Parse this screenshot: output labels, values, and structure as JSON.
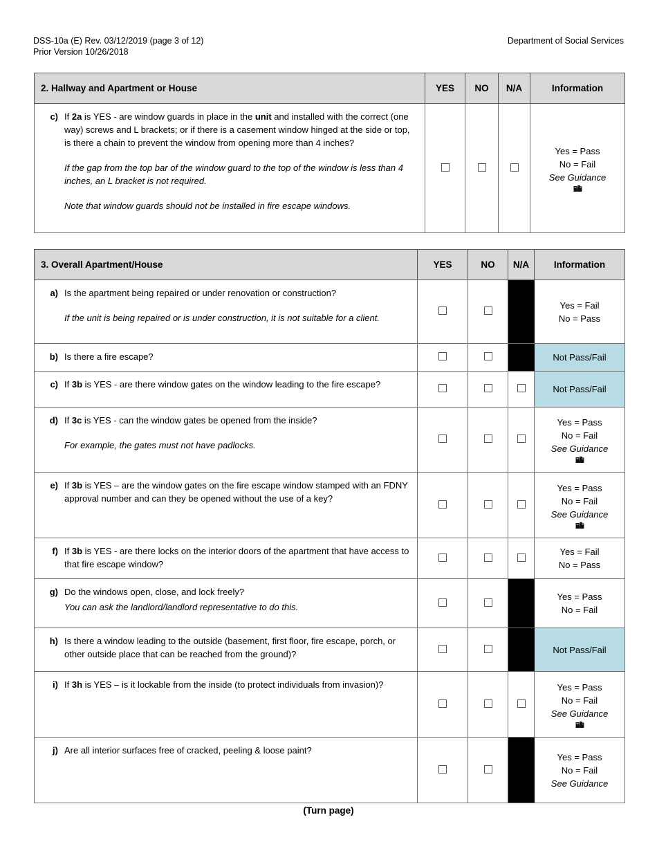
{
  "header": {
    "left_line1": "DSS-10a (E) Rev. 03/12/2019 (page 3 of 12)",
    "left_line2": "Prior Version 10/26/2018",
    "right": "Department of Social Services"
  },
  "colors": {
    "header_gray": "#d9d9d9",
    "not_pass_fail_blue": "#b7dce5",
    "blocked_cell": "#000000",
    "border": "#6f6f6f"
  },
  "columns": {
    "yes": "YES",
    "no": "NO",
    "na": "N/A",
    "information": "Information"
  },
  "section2": {
    "title": "2. Hallway and Apartment or House",
    "rows": [
      {
        "letter": "c)",
        "text_pre": "If ",
        "text_bold1": "2a",
        "text_mid1": " is YES - are window guards in place in the ",
        "text_bold2": "unit",
        "text_post": " and installed with the correct (one way) screws and L brackets; or if there is a casement window hinged at the side or top, is there a chain to prevent the window from opening more than 4 inches?",
        "note1": "If the gap from the top bar of the window guard to the top of the window is less than 4 inches, an L bracket is not required.",
        "note2": "Note that window guards should not be installed in fire escape windows.",
        "yes_checkbox": true,
        "no_checkbox": true,
        "na_checkbox": true,
        "na_blocked": false,
        "info_lines": [
          "Yes = Pass",
          "No = Fail",
          "See Guidance"
        ],
        "info_italic_index": 2,
        "info_blue": false,
        "info_icon": "guidance-books-icon"
      }
    ]
  },
  "section3": {
    "title": "3. Overall Apartment/House",
    "rows": [
      {
        "letter": "a)",
        "text_pre": "Is the apartment being repaired or under renovation or construction?",
        "text_bold1": "",
        "text_mid1": "",
        "text_bold2": "",
        "text_post": "",
        "note1": "If the unit is being repaired or is under construction, it is not suitable for a client.",
        "note2": "",
        "yes_checkbox": true,
        "no_checkbox": true,
        "na_checkbox": false,
        "na_blocked": true,
        "info_lines": [
          "Yes = Fail",
          "No = Pass"
        ],
        "info_italic_index": -1,
        "info_blue": false,
        "info_icon": ""
      },
      {
        "letter": "b)",
        "text_pre": "Is there a fire escape?",
        "text_bold1": "",
        "text_mid1": "",
        "text_bold2": "",
        "text_post": "",
        "note1": "",
        "note2": "",
        "yes_checkbox": true,
        "no_checkbox": true,
        "na_checkbox": false,
        "na_blocked": true,
        "info_lines": [
          "Not Pass/Fail"
        ],
        "info_italic_index": -1,
        "info_blue": true,
        "info_icon": ""
      },
      {
        "letter": "c)",
        "text_pre": "If ",
        "text_bold1": "3b",
        "text_mid1": " is YES - are there window gates on the window leading to the fire escape?",
        "text_bold2": "",
        "text_post": "",
        "note1": "",
        "note2": "",
        "yes_checkbox": true,
        "no_checkbox": true,
        "na_checkbox": true,
        "na_blocked": false,
        "info_lines": [
          "Not Pass/Fail"
        ],
        "info_italic_index": -1,
        "info_blue": true,
        "info_icon": ""
      },
      {
        "letter": "d)",
        "text_pre": "If ",
        "text_bold1": "3c",
        "text_mid1": " is YES - can the window gates be opened from the inside?",
        "text_bold2": "",
        "text_post": "",
        "note1": "For example, the gates must not have padlocks.",
        "note2": "",
        "yes_checkbox": true,
        "no_checkbox": true,
        "na_checkbox": true,
        "na_blocked": false,
        "info_lines": [
          "Yes = Pass",
          "No = Fail",
          "See Guidance"
        ],
        "info_italic_index": 2,
        "info_blue": false,
        "info_icon": "guidance-books-icon"
      },
      {
        "letter": "e)",
        "text_pre": "If ",
        "text_bold1": "3b",
        "text_mid1": " is YES – are the window gates on the fire escape window stamped with an FDNY approval number and can they be opened without the use of a key?",
        "text_bold2": "",
        "text_post": "",
        "note1": "",
        "note2": "",
        "yes_checkbox": true,
        "no_checkbox": true,
        "na_checkbox": true,
        "na_blocked": false,
        "info_lines": [
          "Yes = Pass",
          "No = Fail",
          "See Guidance"
        ],
        "info_italic_index": 2,
        "info_blue": false,
        "info_icon": "guidance-books-icon"
      },
      {
        "letter": "f)",
        "text_pre": "If ",
        "text_bold1": "3b",
        "text_mid1": " is YES - are there locks on the interior doors of the apartment that have access to that fire escape window?",
        "text_bold2": "",
        "text_post": "",
        "note1": "",
        "note2": "",
        "yes_checkbox": true,
        "no_checkbox": true,
        "na_checkbox": true,
        "na_blocked": false,
        "info_lines": [
          "Yes = Fail",
          "No = Pass"
        ],
        "info_italic_index": -1,
        "info_blue": false,
        "info_icon": ""
      },
      {
        "letter": "g)",
        "text_pre": "Do the windows open, close, and lock freely?",
        "text_bold1": "",
        "text_mid1": "",
        "text_bold2": "",
        "text_post": "",
        "note1": "You can ask the landlord/landlord representative to do this.",
        "note2": "",
        "note1_tight": true,
        "yes_checkbox": true,
        "no_checkbox": true,
        "na_checkbox": false,
        "na_blocked": true,
        "info_lines": [
          "Yes = Pass",
          "No = Fail"
        ],
        "info_italic_index": -1,
        "info_blue": false,
        "info_icon": ""
      },
      {
        "letter": "h)",
        "text_pre": "Is there a window leading to the outside (basement, first floor, fire escape, porch, or other outside place that can be reached from the ground)?",
        "text_bold1": "",
        "text_mid1": "",
        "text_bold2": "",
        "text_post": "",
        "note1": "",
        "note2": "",
        "yes_checkbox": true,
        "no_checkbox": true,
        "na_checkbox": false,
        "na_blocked": true,
        "info_lines": [
          "Not Pass/Fail"
        ],
        "info_italic_index": -1,
        "info_blue": true,
        "info_icon": ""
      },
      {
        "letter": "i)",
        "text_pre": "If ",
        "text_bold1": "3h",
        "text_mid1": " is YES – is it lockable from the inside (to protect individuals from invasion)?",
        "text_bold2": "",
        "text_post": "",
        "note1": "",
        "note2": "",
        "yes_checkbox": true,
        "no_checkbox": true,
        "na_checkbox": true,
        "na_blocked": false,
        "info_lines": [
          "Yes = Pass",
          "No = Fail",
          "See Guidance"
        ],
        "info_italic_index": 2,
        "info_blue": false,
        "info_icon": "guidance-books-icon"
      },
      {
        "letter": "j)",
        "text_pre": "Are all interior surfaces free of cracked, peeling & loose paint?",
        "text_bold1": "",
        "text_mid1": "",
        "text_bold2": "",
        "text_post": "",
        "note1": "",
        "note2": "",
        "yes_checkbox": true,
        "no_checkbox": true,
        "na_checkbox": false,
        "na_blocked": true,
        "info_lines": [
          "Yes = Pass",
          "No = Fail",
          "See Guidance"
        ],
        "info_italic_index": 2,
        "info_blue": false,
        "info_icon": ""
      }
    ]
  },
  "footer": {
    "turn_page": "(Turn page)"
  }
}
